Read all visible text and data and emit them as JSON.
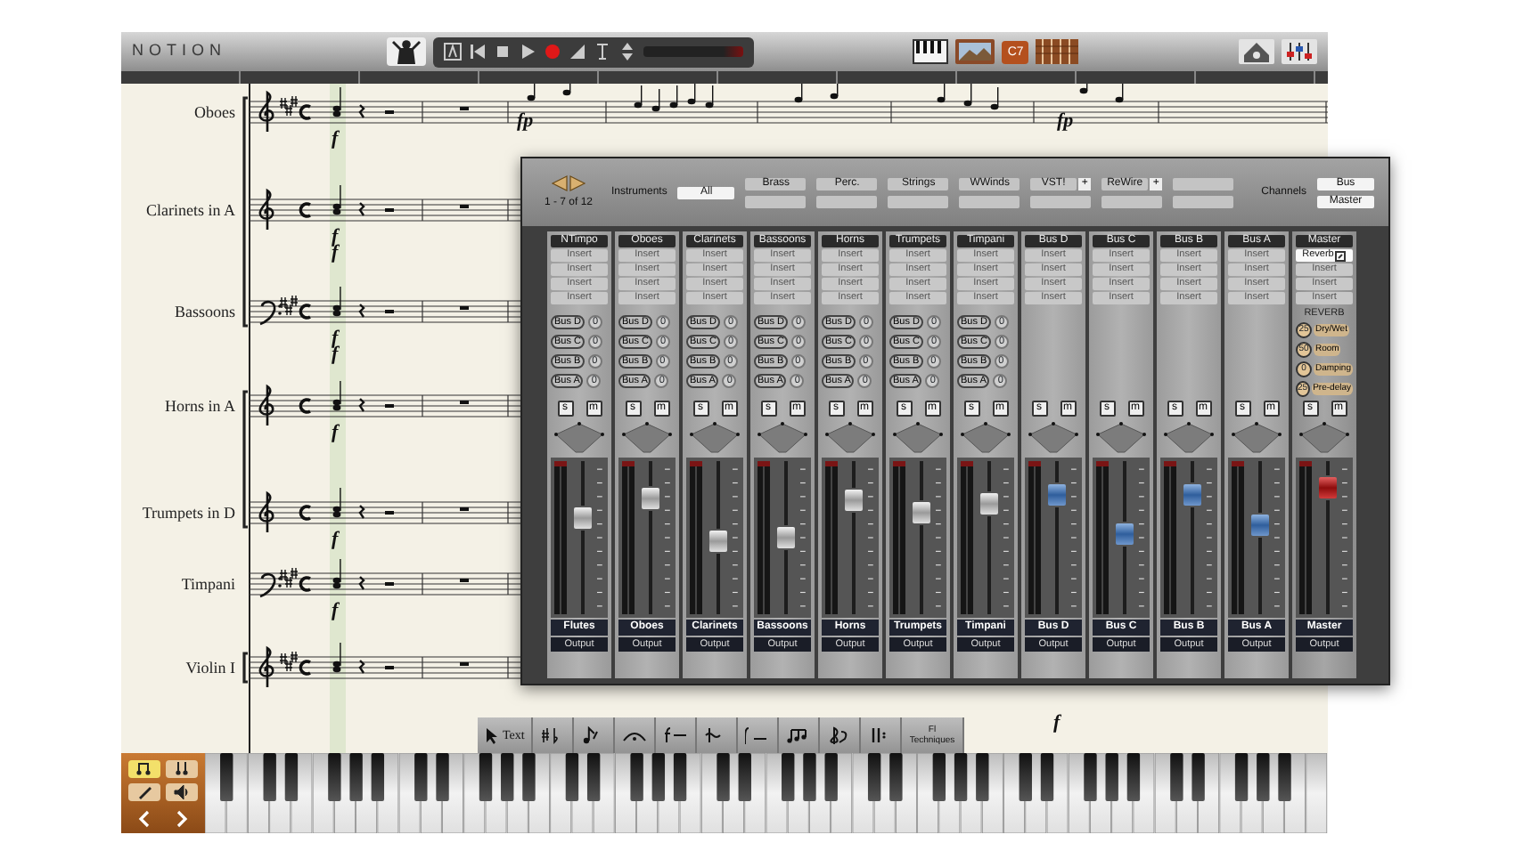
{
  "app": {
    "title": "NOTION",
    "chord_label": "C7"
  },
  "score": {
    "staves": [
      {
        "name": "Oboes",
        "kind": "treble",
        "key_signature": true,
        "dynamics": [
          "f"
        ],
        "marks_above": [
          "fp",
          "fp"
        ]
      },
      {
        "name": "Clarinets in A",
        "kind": "treble",
        "key_signature": false,
        "dynamics": [
          "f",
          "f"
        ]
      },
      {
        "name": "Bassoons",
        "kind": "bass",
        "key_signature": true,
        "dynamics": [
          "f",
          "f"
        ]
      },
      {
        "name": "Horns in A",
        "kind": "treble",
        "key_signature": false,
        "dynamics": [
          "f"
        ]
      },
      {
        "name": "Trumpets in D",
        "kind": "treble",
        "key_signature": false,
        "dynamics": [
          "f"
        ]
      },
      {
        "name": "Timpani",
        "kind": "bass",
        "key_signature": true,
        "dynamics": [
          "f"
        ]
      },
      {
        "name": "Violin I",
        "kind": "treble",
        "key_signature": true,
        "marks_below": [
          "f"
        ]
      }
    ]
  },
  "mixer": {
    "page": "1 - 7 of 12",
    "instruments_label": "Instruments",
    "all": {
      "label": "All",
      "selected": true
    },
    "groups": [
      {
        "label": "Brass",
        "selected": false
      },
      {
        "label": "Perc.",
        "selected": false
      },
      {
        "label": "Strings",
        "selected": false
      },
      {
        "label": "WWinds",
        "selected": false
      },
      {
        "label": "VST!",
        "selected": false,
        "add": "+"
      },
      {
        "label": "ReWire",
        "selected": false,
        "add": "+"
      }
    ],
    "channels_label": "Channels",
    "channels": [
      {
        "label": "Bus",
        "selected": true
      },
      {
        "label": "Master",
        "selected": true
      }
    ],
    "strips": [
      {
        "kind": "instrument",
        "top": "NTimpo",
        "name": "Flutes",
        "output": "Output",
        "level": 0.62,
        "solo": "s",
        "mute": "m",
        "inserts": [
          {
            "label": "Insert",
            "active": false
          },
          {
            "label": "Insert",
            "active": false
          },
          {
            "label": "Insert",
            "active": false
          },
          {
            "label": "Insert",
            "active": false
          }
        ],
        "sends": [
          {
            "bus": "Bus D",
            "value": "0"
          },
          {
            "bus": "Bus C",
            "value": "0"
          },
          {
            "bus": "Bus B",
            "value": "0"
          },
          {
            "bus": "Bus A",
            "value": "0"
          }
        ]
      },
      {
        "kind": "instrument",
        "top": "Oboes",
        "name": "Oboes",
        "output": "Output",
        "level": 0.78,
        "solo": "s",
        "mute": "m",
        "inserts": [
          {
            "label": "Insert",
            "active": false
          },
          {
            "label": "Insert",
            "active": false
          },
          {
            "label": "Insert",
            "active": false
          },
          {
            "label": "Insert",
            "active": false
          }
        ],
        "sends": [
          {
            "bus": "Bus D",
            "value": "0"
          },
          {
            "bus": "Bus C",
            "value": "0"
          },
          {
            "bus": "Bus B",
            "value": "0"
          },
          {
            "bus": "Bus A",
            "value": "0"
          }
        ]
      },
      {
        "kind": "instrument",
        "top": "Clarinets",
        "name": "Clarinets",
        "output": "Output",
        "level": 0.45,
        "solo": "s",
        "mute": "m",
        "inserts": [
          {
            "label": "Insert",
            "active": false
          },
          {
            "label": "Insert",
            "active": false
          },
          {
            "label": "Insert",
            "active": false
          },
          {
            "label": "Insert",
            "active": false
          }
        ],
        "sends": [
          {
            "bus": "Bus D",
            "value": "0"
          },
          {
            "bus": "Bus C",
            "value": "0"
          },
          {
            "bus": "Bus B",
            "value": "0"
          },
          {
            "bus": "Bus A",
            "value": "0"
          }
        ]
      },
      {
        "kind": "instrument",
        "top": "Bassoons",
        "name": "Bassoons",
        "output": "Output",
        "level": 0.47,
        "solo": "s",
        "mute": "m",
        "inserts": [
          {
            "label": "Insert",
            "active": false
          },
          {
            "label": "Insert",
            "active": false
          },
          {
            "label": "Insert",
            "active": false
          },
          {
            "label": "Insert",
            "active": false
          }
        ],
        "sends": [
          {
            "bus": "Bus D",
            "value": "0"
          },
          {
            "bus": "Bus C",
            "value": "0"
          },
          {
            "bus": "Bus B",
            "value": "0"
          },
          {
            "bus": "Bus A",
            "value": "0"
          }
        ]
      },
      {
        "kind": "instrument",
        "top": "Horns",
        "name": "Horns",
        "output": "Output",
        "level": 0.76,
        "solo": "s",
        "mute": "m",
        "inserts": [
          {
            "label": "Insert",
            "active": false
          },
          {
            "label": "Insert",
            "active": false
          },
          {
            "label": "Insert",
            "active": false
          },
          {
            "label": "Insert",
            "active": false
          }
        ],
        "sends": [
          {
            "bus": "Bus D",
            "value": "0"
          },
          {
            "bus": "Bus C",
            "value": "0"
          },
          {
            "bus": "Bus B",
            "value": "0"
          },
          {
            "bus": "Bus A",
            "value": "0"
          }
        ]
      },
      {
        "kind": "instrument",
        "top": "Trumpets",
        "name": "Trumpets",
        "output": "Output",
        "level": 0.66,
        "solo": "s",
        "mute": "m",
        "inserts": [
          {
            "label": "Insert",
            "active": false
          },
          {
            "label": "Insert",
            "active": false
          },
          {
            "label": "Insert",
            "active": false
          },
          {
            "label": "Insert",
            "active": false
          }
        ],
        "sends": [
          {
            "bus": "Bus D",
            "value": "0"
          },
          {
            "bus": "Bus C",
            "value": "0"
          },
          {
            "bus": "Bus B",
            "value": "0"
          },
          {
            "bus": "Bus A",
            "value": "0"
          }
        ]
      },
      {
        "kind": "instrument",
        "top": "Timpani",
        "name": "Timpani",
        "output": "Output",
        "level": 0.74,
        "solo": "s",
        "mute": "m",
        "inserts": [
          {
            "label": "Insert",
            "active": false
          },
          {
            "label": "Insert",
            "active": false
          },
          {
            "label": "Insert",
            "active": false
          },
          {
            "label": "Insert",
            "active": false
          }
        ],
        "sends": [
          {
            "bus": "Bus D",
            "value": "0"
          },
          {
            "bus": "Bus C",
            "value": "0"
          },
          {
            "bus": "Bus B",
            "value": "0"
          },
          {
            "bus": "Bus A",
            "value": "0"
          }
        ]
      },
      {
        "kind": "bus",
        "top": "Bus D",
        "name": "Bus D",
        "output": "Output",
        "level": 0.8,
        "solo": "s",
        "mute": "m",
        "inserts": [
          {
            "label": "Insert",
            "active": false
          },
          {
            "label": "Insert",
            "active": false
          },
          {
            "label": "Insert",
            "active": false
          },
          {
            "label": "Insert",
            "active": false
          }
        ]
      },
      {
        "kind": "bus",
        "top": "Bus C",
        "name": "Bus C",
        "output": "Output",
        "level": 0.5,
        "solo": "s",
        "mute": "m",
        "inserts": [
          {
            "label": "Insert",
            "active": false
          },
          {
            "label": "Insert",
            "active": false
          },
          {
            "label": "Insert",
            "active": false
          },
          {
            "label": "Insert",
            "active": false
          }
        ]
      },
      {
        "kind": "bus",
        "top": "Bus B",
        "name": "Bus B",
        "output": "Output",
        "level": 0.8,
        "solo": "s",
        "mute": "m",
        "inserts": [
          {
            "label": "Insert",
            "active": false
          },
          {
            "label": "Insert",
            "active": false
          },
          {
            "label": "Insert",
            "active": false
          },
          {
            "label": "Insert",
            "active": false
          }
        ]
      },
      {
        "kind": "bus",
        "top": "Bus A",
        "name": "Bus A",
        "output": "Output",
        "level": 0.57,
        "solo": "s",
        "mute": "m",
        "inserts": [
          {
            "label": "Insert",
            "active": false
          },
          {
            "label": "Insert",
            "active": false
          },
          {
            "label": "Insert",
            "active": false
          },
          {
            "label": "Insert",
            "active": false
          }
        ]
      },
      {
        "kind": "master",
        "top": "Master",
        "name": "Master",
        "output": "Output",
        "level": 0.86,
        "solo": "s",
        "mute": "m",
        "inserts": [
          {
            "label": "Reverb",
            "active": true
          },
          {
            "label": "Insert",
            "active": false
          },
          {
            "label": "Insert",
            "active": false
          },
          {
            "label": "Insert",
            "active": false
          }
        ],
        "reverb": {
          "title": "REVERB",
          "params": [
            {
              "value": "25",
              "label": "Dry/Wet"
            },
            {
              "value": "50",
              "label": "Room"
            },
            {
              "value": "0",
              "label": "Damping"
            },
            {
              "value": "25",
              "label": "Pre-delay"
            }
          ]
        }
      }
    ]
  },
  "tool_palette": [
    {
      "kind": "text",
      "label": "Text"
    },
    {
      "kind": "accidentals"
    },
    {
      "kind": "notes"
    },
    {
      "kind": "fermata"
    },
    {
      "kind": "hairpin"
    },
    {
      "kind": "ornament"
    },
    {
      "kind": "dynamics"
    },
    {
      "kind": "tuplet"
    },
    {
      "kind": "clef"
    },
    {
      "kind": "barline"
    },
    {
      "kind": "technique",
      "label": "Fl",
      "sublabel": "Techniques"
    }
  ],
  "keyboard_panel": [
    {
      "kind": "notes",
      "selected": true
    },
    {
      "kind": "chords",
      "selected": false
    },
    {
      "kind": "pencil",
      "selected": false
    },
    {
      "kind": "speaker",
      "selected": false
    }
  ],
  "keyboard_nav": [
    {
      "kind": "prev"
    },
    {
      "kind": "next"
    }
  ]
}
